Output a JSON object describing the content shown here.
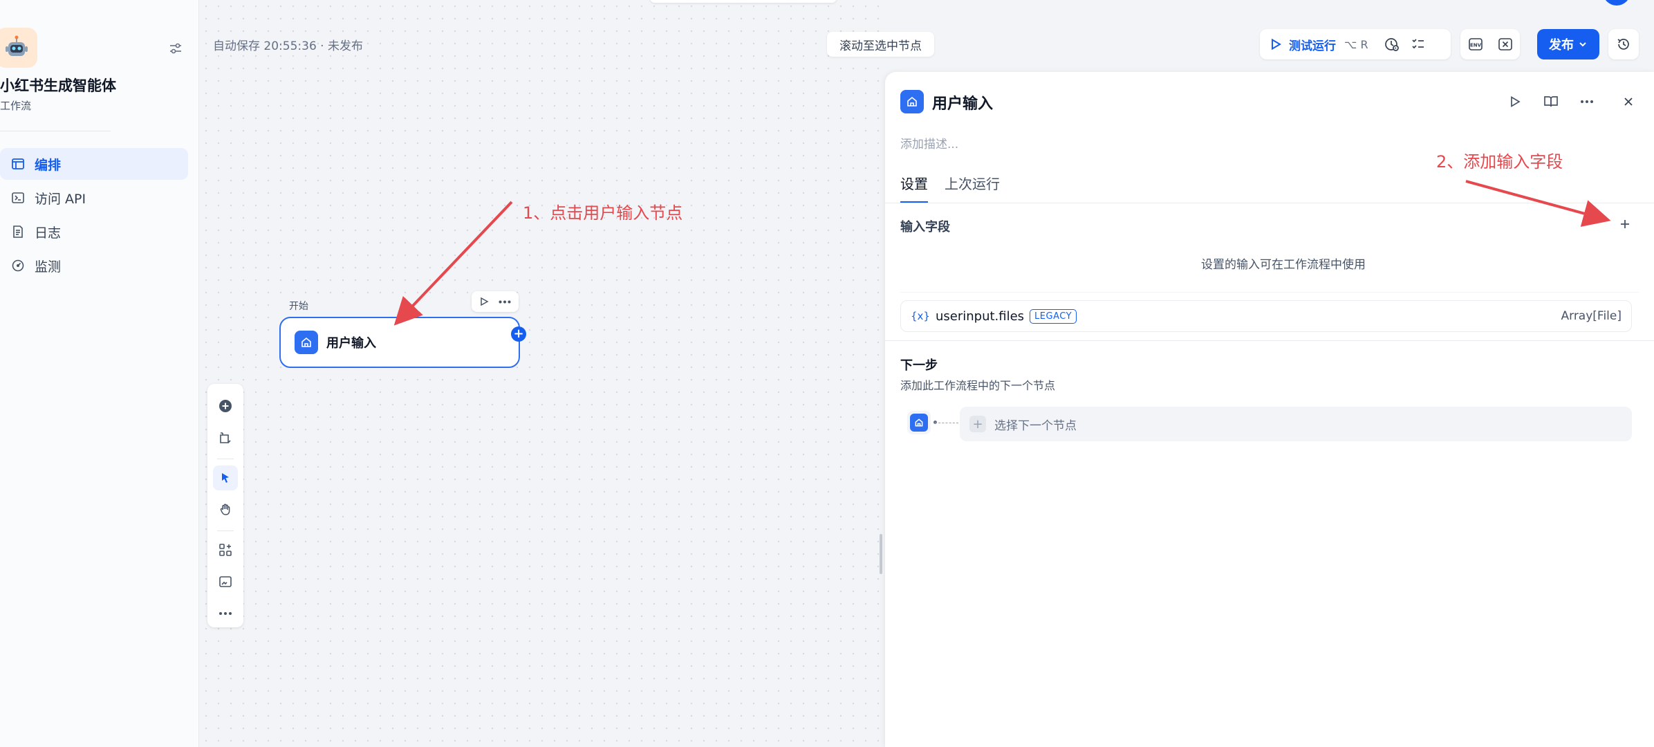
{
  "app": {
    "name": "小红书生成智能体",
    "type": "工作流"
  },
  "sidebar": {
    "items": [
      {
        "label": "编排",
        "icon": "layout-icon",
        "active": true
      },
      {
        "label": "访问 API",
        "icon": "terminal-icon",
        "active": false
      },
      {
        "label": "日志",
        "icon": "log-icon",
        "active": false
      },
      {
        "label": "监测",
        "icon": "gauge-icon",
        "active": false
      }
    ]
  },
  "header": {
    "autosave": "自动保存 20:55:36 · 未发布",
    "scroll_to_node": "滚动至选中节点",
    "test_run": "测试运行",
    "test_run_shortcut": "⌥ R",
    "publish": "发布",
    "accent_color": "#155eef"
  },
  "canvas": {
    "node_group_label": "开始",
    "node_label": "用户输入",
    "annotation1": "1、点击用户输入节点"
  },
  "panel": {
    "title": "用户输入",
    "description_placeholder": "添加描述...",
    "annotation2": "2、添加输入字段",
    "tabs": [
      {
        "label": "设置",
        "active": true
      },
      {
        "label": "上次运行",
        "active": false
      }
    ],
    "input_fields_title": "输入字段",
    "input_hint": "设置的输入可在工作流程中使用",
    "variable": {
      "prefix": "{x}",
      "name": "userinput.files",
      "badge": "LEGACY",
      "type": "Array[File]"
    },
    "next_step_title": "下一步",
    "next_step_desc": "添加此工作流程中的下一个节点",
    "select_next": "选择下一个节点"
  },
  "annotation_color": "#e5484d"
}
